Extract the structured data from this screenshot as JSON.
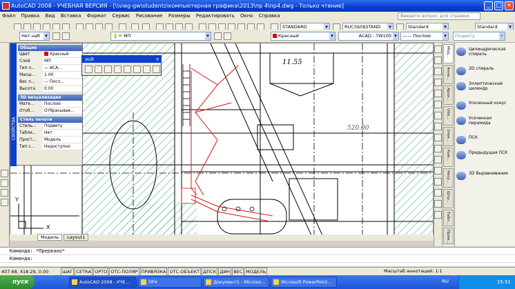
{
  "window": {
    "title": "AutoCAD 2008 - УЧЕБНАЯ ВЕРСИЯ - [\\\\vieg-gw\\students\\компьютерная графика\\2013\\пр 4\\пр4.dwg - Только чтение]"
  },
  "menu": {
    "items": [
      "Файл",
      "Правка",
      "Вид",
      "Вставка",
      "Формат",
      "Сервис",
      "Рисование",
      "Размеры",
      "Редактировать",
      "Окно",
      "Справка"
    ],
    "help_placeholder": "Введите вопрос для справки"
  },
  "toolbar1": {
    "text_style": "STANDARD",
    "dim_style": "RUCS$0$STAND",
    "table_style": "Standard",
    "workspace": "Standard"
  },
  "toolbar2": {
    "named_combo": "Нет наб",
    "layer": "МП",
    "color": "Красный",
    "linetype": "ACAD...7W100",
    "linetype_suffix": "Послою",
    "lineweight": "Послою",
    "plotstyle": "Подвету"
  },
  "properties": {
    "panel_title": "СВОЙСТВА",
    "general": {
      "header": "Общие",
      "rows": [
        {
          "k": "Цвет",
          "v": "Красный"
        },
        {
          "k": "Слой",
          "v": "МП"
        },
        {
          "k": "Тип л...",
          "v": "— ACA..."
        },
        {
          "k": "Масш...",
          "v": "1.00"
        },
        {
          "k": "Вес л...",
          "v": "— Посл..."
        },
        {
          "k": "Высота",
          "v": "0.00"
        }
      ]
    },
    "viz3d": {
      "header": "3D визуализация",
      "rows": [
        {
          "k": "Мате...",
          "v": "Послою"
        },
        {
          "k": "Отоб...",
          "v": "Отбрасывае..."
        }
      ]
    },
    "plot": {
      "header": "Стиль печати",
      "rows": [
        {
          "k": "Стиль...",
          "v": "Подвету"
        },
        {
          "k": "Табли...",
          "v": "Нет"
        },
        {
          "k": "Прост...",
          "v": "Модель"
        },
        {
          "k": "Тип с...",
          "v": "Недоступно"
        }
      ]
    }
  },
  "float_toolbar": {
    "title": "ault"
  },
  "drawing": {
    "dim_top": "11.55",
    "dim_mid": "520.00",
    "axis_x": "X",
    "axis_y": "Y"
  },
  "layout_tabs": [
    "Модель",
    "Layout1"
  ],
  "palette_tabs": [
    "Мод...",
    "Анно...",
    "Архи...",
    "Обо...",
    "Элек...",
    "Ком...",
    "Несу...",
    "Штр...",
    "Табл...",
    "Прим..."
  ],
  "tool_palette": [
    {
      "label": "Цилиндрическая спираль",
      "icon": "helix-icon"
    },
    {
      "label": "2D спираль",
      "icon": "spiral-icon"
    },
    {
      "label": "Эллиптический цилиндр",
      "icon": "cylinder-icon"
    },
    {
      "label": "Усеченный конус",
      "icon": "cone-icon"
    },
    {
      "label": "Усеченная пирамида",
      "icon": "pyramid-icon"
    },
    {
      "label": "ПСК",
      "icon": "ucs-icon"
    },
    {
      "label": "Предыдущая ПСК",
      "icon": "ucs-prev-icon"
    },
    {
      "label": "3D Выравнивание",
      "icon": "align3d-icon"
    }
  ],
  "command": {
    "line1": "Команда: *Прервано*",
    "line2": "Команда:"
  },
  "status": {
    "coords": "407.68, 418.29, 0.00",
    "buttons": [
      "ШАГ",
      "СЕТКА",
      "ОРТО",
      "ОТС-ПОЛЯР",
      "ПРИВЯЗКА",
      "ОТС-ОБЪЕКТ",
      "ДПСК",
      "ДИН",
      "ВЕС",
      "МОДЕЛЬ"
    ],
    "annotation_scale": "Масштаб аннотаций: 1:1"
  },
  "taskbar": {
    "start": "пуск",
    "tasks": [
      "AutoCAD 2008 - УЧЕ...",
      "ПР4",
      "Документ1 - Microso...",
      "Microsoft PowerPoint..."
    ],
    "lang": "RU",
    "clock": "15:51"
  }
}
